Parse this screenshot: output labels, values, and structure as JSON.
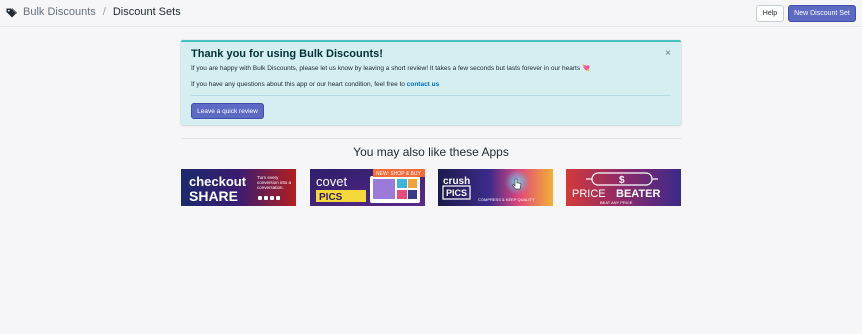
{
  "breadcrumb": {
    "app": "Bulk Discounts",
    "separator": "/",
    "current": "Discount Sets"
  },
  "header": {
    "help_label": "Help",
    "new_label": "New Discount Set"
  },
  "banner": {
    "title": "Thank you for using Bulk Discounts!",
    "line1": "If you are happy with Bulk Discounts, please let us know by leaving a short review! It takes a few seconds but lasts forever in our hearts",
    "heart": "💘",
    "line2_prefix": "If you have any questions about this app or our heart condition, feel free to",
    "contact_label": "contact us",
    "review_button": "Leave a quick review",
    "close": "×"
  },
  "apps_section": {
    "title": "You may also like these Apps",
    "apps": [
      {
        "name_a": "checkout",
        "name_b": "SHARE",
        "tagline": "Turn every conversion into a conversation."
      },
      {
        "name_a": "covet",
        "name_b": "PICS",
        "badge": "NEW: SHOP & BUY"
      },
      {
        "name_a": "crush",
        "name_b": "PICS",
        "tagline": "COMPRESS & KEEP QUALITY"
      },
      {
        "name_a": "PRICE",
        "name_b": "BEATER",
        "tagline": "BEAT ANY PRICE",
        "symbol": "$"
      }
    ]
  },
  "colors": {
    "primary": "#5c6ac4",
    "banner_bg": "#d4eef2",
    "banner_border": "#47c1bf",
    "link": "#006fbb"
  },
  "icons": {
    "breadcrumb": "tag-icon",
    "close": "close-icon",
    "hand_cursor": "pointer-hand-icon"
  }
}
